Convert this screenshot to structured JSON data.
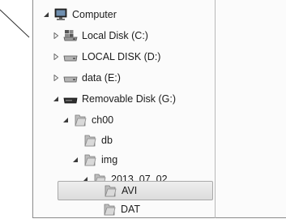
{
  "tree": {
    "items": [
      {
        "label": "Computer",
        "icon": "computer-icon",
        "expanded": true
      },
      {
        "label": "Local Disk (C:)",
        "icon": "system-drive-icon",
        "expanded": false
      },
      {
        "label": "LOCAL DISK (D:)",
        "icon": "drive-icon",
        "expanded": false
      },
      {
        "label": "data (E:)",
        "icon": "drive-icon",
        "expanded": false
      },
      {
        "label": "Removable Disk (G:)",
        "icon": "removable-drive-icon",
        "expanded": true
      },
      {
        "label": "ch00",
        "icon": "folder-icon",
        "expanded": true
      },
      {
        "label": "db",
        "icon": "folder-icon",
        "expanded": null
      },
      {
        "label": "img",
        "icon": "folder-icon",
        "expanded": true
      },
      {
        "label": "2013_07_02",
        "icon": "folder-icon",
        "expanded": true
      },
      {
        "label": "AVI",
        "icon": "folder-icon",
        "expanded": null,
        "selected": true
      },
      {
        "label": "DAT",
        "icon": "folder-icon",
        "expanded": null
      }
    ]
  }
}
